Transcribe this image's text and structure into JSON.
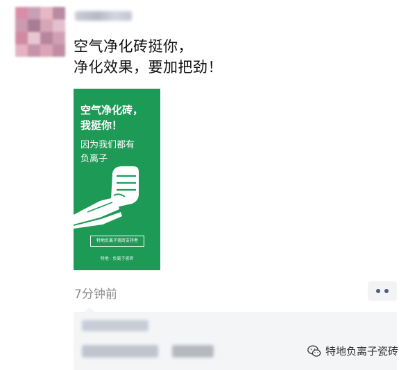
{
  "post": {
    "text_line1": "空气净化砖挺你，",
    "text_line2": "净化效果，要加把劲！",
    "timestamp": "7分钟前"
  },
  "poster": {
    "headline_line1": "空气净化砖，",
    "headline_line2": "我挺你！",
    "sub_line1": "因为我们都有",
    "sub_line2": "负离子",
    "badge_text": "特地负离子瓷砖支持者",
    "footer_text": "特地 · 负离子瓷砖",
    "background_color": "#1e9a57"
  },
  "watermark": {
    "text": "特地负离子瓷砖",
    "icon": "wechat-icon"
  },
  "more_button": {
    "icon": "more-dots-icon"
  }
}
